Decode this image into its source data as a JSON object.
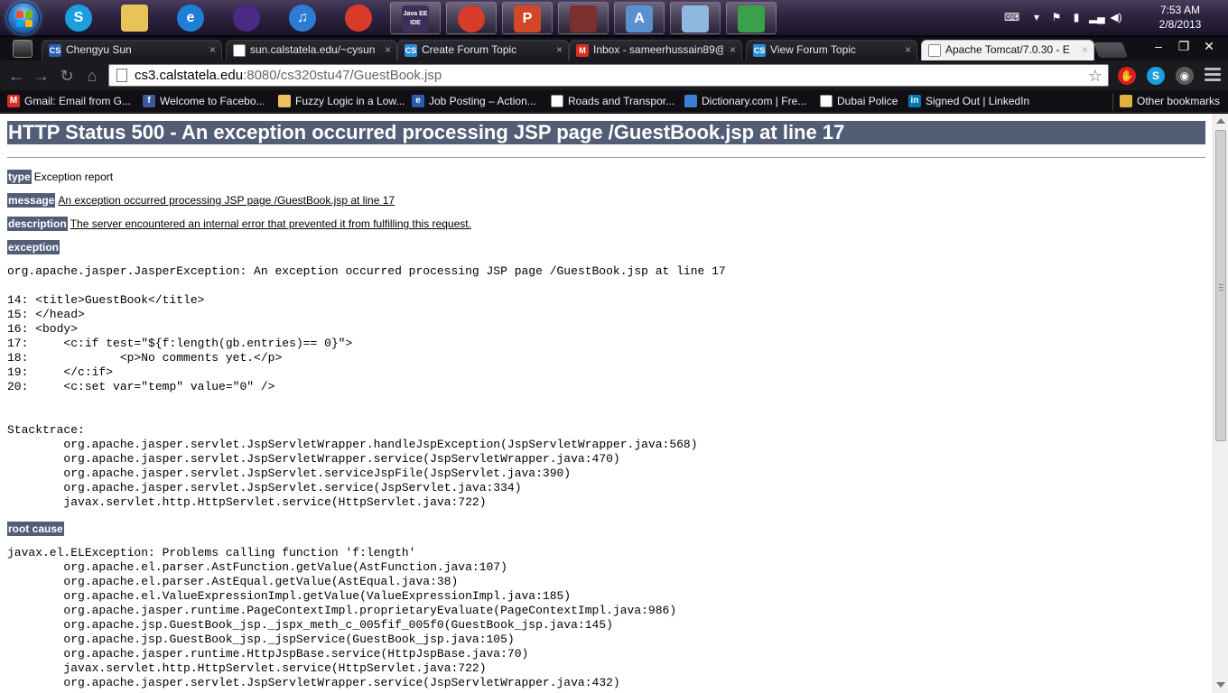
{
  "taskbar": {
    "clock_time": "7:53 AM",
    "clock_date": "2/8/2013",
    "apps": [
      {
        "name": "skype",
        "glyph": "S",
        "color": "#1a9fe0"
      },
      {
        "name": "explorer",
        "glyph": "",
        "color": "#e7c45a"
      },
      {
        "name": "ie",
        "glyph": "e",
        "color": "#1e7fd6"
      },
      {
        "name": "eclipse",
        "glyph": "",
        "color": "#4b2a86"
      },
      {
        "name": "itunes",
        "glyph": "♫",
        "color": "#2d7bd6"
      },
      {
        "name": "chrome",
        "glyph": "",
        "color": "#d93b2b"
      },
      {
        "name": "java-ee-ide",
        "glyph": "Java EE IDE",
        "color": "#3e2f5a"
      },
      {
        "name": "chrome-open",
        "glyph": "",
        "color": "#d93b2b"
      },
      {
        "name": "powerpoint",
        "glyph": "P",
        "color": "#d24726"
      },
      {
        "name": "winrar",
        "glyph": "",
        "color": "#7b2f2f"
      },
      {
        "name": "wordpad",
        "glyph": "A",
        "color": "#5a8fd0"
      },
      {
        "name": "notepad",
        "glyph": "",
        "color": "#8fb8e0"
      },
      {
        "name": "network",
        "glyph": "",
        "color": "#3aa04a"
      }
    ]
  },
  "tabs": [
    {
      "title": "Chengyu Sun",
      "favicon": "CS",
      "favicon_color": "#2b5fb3"
    },
    {
      "title": "sun.calstatela.edu/~cysun",
      "favicon": "",
      "favicon_color": "#ffffff"
    },
    {
      "title": "Create Forum Topic",
      "favicon": "CS",
      "favicon_color": "#2a8ed6"
    },
    {
      "title": "Inbox - sameerhussain89@",
      "favicon": "M",
      "favicon_color": "#d93025"
    },
    {
      "title": "View Forum Topic",
      "favicon": "CS",
      "favicon_color": "#2a8ed6"
    },
    {
      "title": "Apache Tomcat/7.0.30 - E",
      "favicon": "",
      "favicon_color": "#ffffff"
    }
  ],
  "omnibox": {
    "host": "cs3.calstatela.edu",
    "rest": ":8080/cs320stu47/GuestBook.jsp"
  },
  "bookmarks": [
    {
      "label": "Gmail: Email from G...",
      "icon": "M",
      "color": "#d93025"
    },
    {
      "label": "Welcome to Facebo...",
      "icon": "f",
      "color": "#3b5998"
    },
    {
      "label": "Fuzzy Logic in a Low...",
      "icon": "",
      "color": "#f0c060"
    },
    {
      "label": "Job Posting – Action...",
      "icon": "e",
      "color": "#2a5db0"
    },
    {
      "label": "Roads and Transpor...",
      "icon": "",
      "color": "#ffffff"
    },
    {
      "label": "Dictionary.com | Fre...",
      "icon": "",
      "color": "#3a7fd0"
    },
    {
      "label": "Dubai Police",
      "icon": "",
      "color": "#ffffff"
    },
    {
      "label": "Signed Out | LinkedIn",
      "icon": "in",
      "color": "#0077b5"
    },
    {
      "label": "Other bookmarks",
      "icon": "",
      "color": "#e0b040"
    }
  ],
  "page": {
    "title": "HTTP Status 500 - An exception occurred processing JSP page /GuestBook.jsp at line 17",
    "type_label": "type",
    "type_value": "Exception report",
    "message_label": "message",
    "message_value": "An exception occurred processing JSP page /GuestBook.jsp at line 17",
    "description_label": "description",
    "description_value": "The server encountered an internal error that prevented it from fulfilling this request.",
    "exception_label": "exception",
    "exception_text": "org.apache.jasper.JasperException: An exception occurred processing JSP page /GuestBook.jsp at line 17\n\n14: <title>GuestBook</title>\n15: </head>\n16: <body>\n17: \t<c:if test=\"${f:length(gb.entries)== 0}\">\n18: \t\t<p>No comments yet.</p>\n19: \t</c:if>\n20: \t<c:set var=\"temp\" value=\"0\" />\n\n\nStacktrace:\n\torg.apache.jasper.servlet.JspServletWrapper.handleJspException(JspServletWrapper.java:568)\n\torg.apache.jasper.servlet.JspServletWrapper.service(JspServletWrapper.java:470)\n\torg.apache.jasper.servlet.JspServlet.serviceJspFile(JspServlet.java:390)\n\torg.apache.jasper.servlet.JspServlet.service(JspServlet.java:334)\n\tjavax.servlet.http.HttpServlet.service(HttpServlet.java:722)",
    "root_cause_label": "root cause",
    "root_cause_text": "javax.el.ELException: Problems calling function 'f:length'\n\torg.apache.el.parser.AstFunction.getValue(AstFunction.java:107)\n\torg.apache.el.parser.AstEqual.getValue(AstEqual.java:38)\n\torg.apache.el.ValueExpressionImpl.getValue(ValueExpressionImpl.java:185)\n\torg.apache.jasper.runtime.PageContextImpl.proprietaryEvaluate(PageContextImpl.java:986)\n\torg.apache.jsp.GuestBook_jsp._jspx_meth_c_005fif_005f0(GuestBook_jsp.java:145)\n\torg.apache.jsp.GuestBook_jsp._jspService(GuestBook_jsp.java:105)\n\torg.apache.jasper.runtime.HttpJspBase.service(HttpJspBase.java:70)\n\tjavax.servlet.http.HttpServlet.service(HttpServlet.java:722)\n\torg.apache.jasper.servlet.JspServletWrapper.service(JspServletWrapper.java:432)"
  }
}
